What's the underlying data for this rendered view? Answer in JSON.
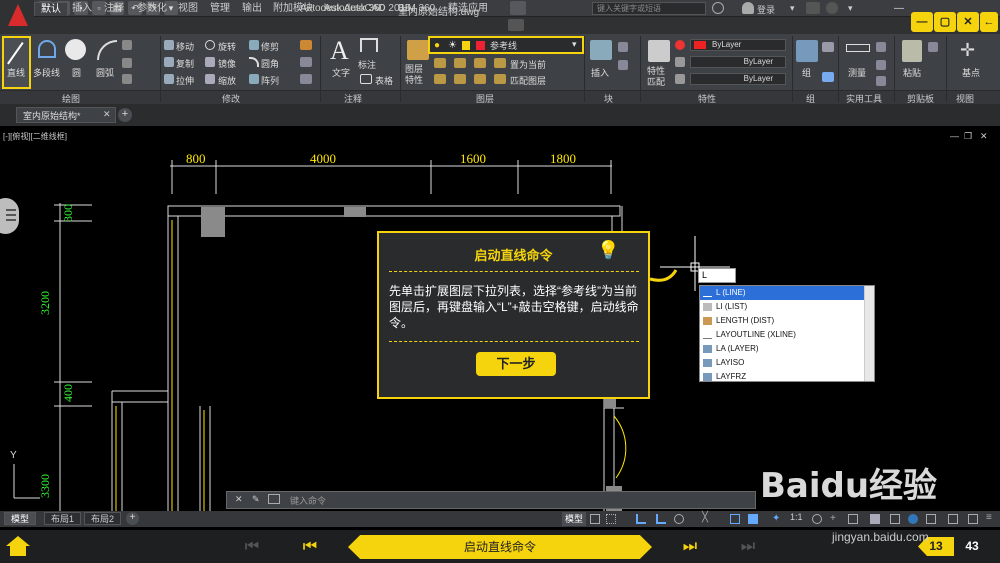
{
  "titlebar": {
    "app_title": "Autodesk AutoCAD 2015",
    "doc_name": "室内原始结构.dwg",
    "search_placeholder": "键入关键字或短语",
    "login": "登录"
  },
  "ribbon_tabs": [
    "默认",
    "插入",
    "注释",
    "参数化",
    "视图",
    "管理",
    "输出",
    "附加模块",
    "Autodesk 360",
    "BIM 360",
    "精选应用"
  ],
  "draw_panel": {
    "line": "直线",
    "polyline": "多段线",
    "circle": "圆",
    "arc": "圆弧",
    "label": "绘图"
  },
  "modify_panel": {
    "move": "移动",
    "rotate": "旋转",
    "trim": "修剪",
    "copy": "复制",
    "mirror": "镜像",
    "fillet": "圆角",
    "stretch": "拉伸",
    "scale": "缩放",
    "array": "阵列",
    "label": "修改"
  },
  "annotation_panel": {
    "text": "文字",
    "dimension": "标注",
    "table": "表格",
    "label": "注释"
  },
  "layers_panel": {
    "properties": "图层特性",
    "current_layer": "参考线",
    "set_current": "置为当前",
    "match": "匹配图层",
    "label": "图层"
  },
  "block_panel": {
    "insert": "插入",
    "label": "块"
  },
  "properties_panel": {
    "match": "特性匹配",
    "color": "ByLayer",
    "linetype": "ByLayer",
    "lineweight": "ByLayer",
    "label": "特性"
  },
  "group_panel": {
    "group": "组",
    "label": "组"
  },
  "utilities_panel": {
    "measure": "测量",
    "label": "实用工具"
  },
  "clipboard_panel": {
    "paste": "粘贴",
    "label": "剪贴板"
  },
  "view_panel": {
    "base": "基点",
    "label": "视图"
  },
  "doc_tab": "室内原始结构*",
  "viewport_label": "[-][俯视][二维线框]",
  "dimensions": {
    "top": [
      "800",
      "4000",
      "1600",
      "1800"
    ],
    "left": [
      "300",
      "3200",
      "400",
      "3300"
    ]
  },
  "tip": {
    "title": "启动直线命令",
    "body": "先单击扩展图层下拉列表，选择“参考线”为当前图层后，再键盘输入“L”+敲击空格键，启动线命令。",
    "next_button": "下一步"
  },
  "command_input": "L",
  "autocomplete": [
    "L (LINE)",
    "LI (LIST)",
    "LENGTH (DIST)",
    "LAYOUTLINE (XLINE)",
    "LA (LAYER)",
    "LAYISO",
    "LAYFRZ"
  ],
  "command_line_placeholder": "键入命令",
  "layout_tabs": [
    "模型",
    "布局1",
    "布局2"
  ],
  "status_model": "模型",
  "status_scale": "1:1",
  "tutorial": {
    "step_title": "启动直线命令",
    "current_page": "13",
    "total_pages": "43"
  },
  "watermark": "Baidu经验",
  "watermark_url": "jingyan.baidu.com",
  "colors": {
    "accent": "#f5d40e",
    "dim_yellow": "#ffe800",
    "dim_green": "#31ff2d",
    "selection": "#2c6fd9"
  }
}
